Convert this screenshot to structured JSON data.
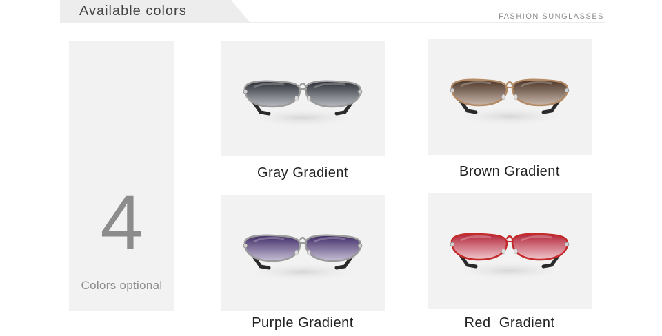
{
  "header": {
    "title": "Available colors",
    "subtitle": "FASHION SUNGLASSES"
  },
  "count_panel": {
    "number": "4",
    "label": "Colors optional"
  },
  "colors": [
    {
      "label": "Gray Gradient",
      "lens_top": "#2b2d35",
      "lens_bottom": "#b9bbc2",
      "frame": "#9b9b9b"
    },
    {
      "label": "Brown Gradient",
      "lens_top": "#4a3426",
      "lens_bottom": "#c9b7ab",
      "frame": "#b38a64"
    },
    {
      "label": "Purple Gradient",
      "lens_top": "#3e2a66",
      "lens_bottom": "#c7bfd6",
      "frame": "#9b9b9b"
    },
    {
      "label": "Red  Gradient",
      "lens_top": "#b3253a",
      "lens_bottom": "#f0c7cd",
      "frame": "#c42a2a"
    }
  ]
}
